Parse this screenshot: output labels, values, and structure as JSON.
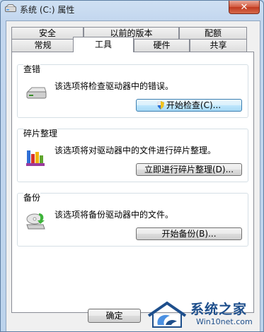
{
  "window": {
    "title": "系统 (C:) 属性",
    "close_label": "✕"
  },
  "tabs_row1": [
    {
      "label": "安全"
    },
    {
      "label": "以前的版本"
    },
    {
      "label": "配额"
    }
  ],
  "tabs_row2": [
    {
      "label": "常规"
    },
    {
      "label": "工具",
      "selected": true
    },
    {
      "label": "硬件"
    },
    {
      "label": "共享"
    }
  ],
  "groups": {
    "check": {
      "title": "查错",
      "description": "该选项将检查驱动器中的错误。",
      "button": "开始检查(C)..."
    },
    "defrag": {
      "title": "碎片整理",
      "description": "该选项将对驱动器中的文件进行碎片整理。",
      "button": "立即进行碎片整理(D)..."
    },
    "backup": {
      "title": "备份",
      "description": "该选项将备份驱动器中的文件。",
      "button": "开始备份(B)..."
    }
  },
  "footer": {
    "ok": "确定"
  },
  "watermark": {
    "brand": "系统之家",
    "url": "Win10net.com"
  },
  "colors": {
    "accent": "#1e4f8c",
    "close": "#c0391f"
  }
}
